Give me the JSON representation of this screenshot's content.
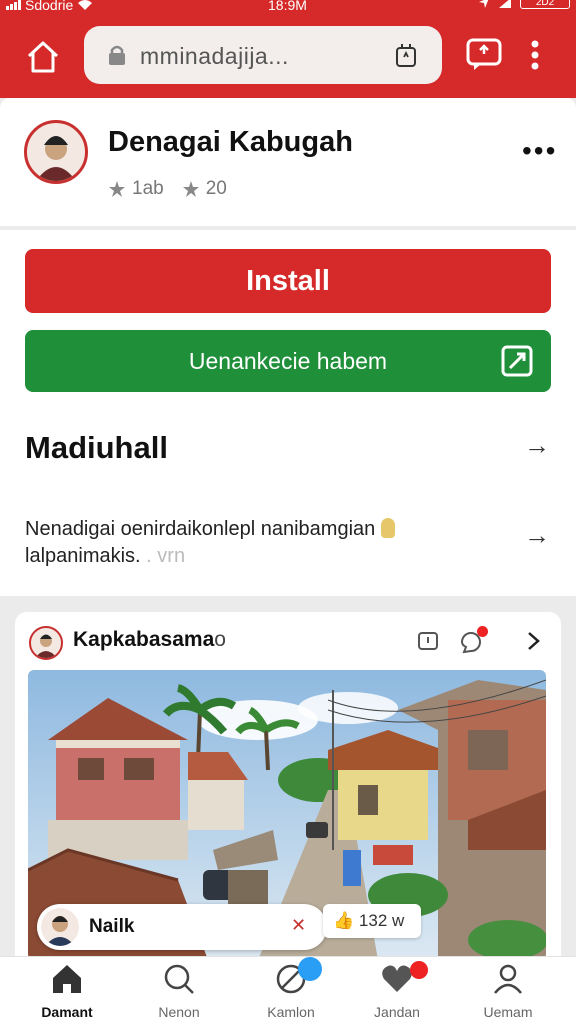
{
  "status_bar": {
    "carrier": "Sdodrie",
    "time": "18:9M",
    "battery": "2D2"
  },
  "browser": {
    "url": "mminadajija..."
  },
  "app": {
    "name": "Denagai Kabugah",
    "rating_count": "1ab",
    "rating_value": "20",
    "more_label": "•••"
  },
  "actions": {
    "install_label": "Install",
    "secondary_label": "Uenankecie habem"
  },
  "section": {
    "title": "Madiuhall",
    "description_line1": "Nenadigai oenirdaikonlepl nanibamgian",
    "description_line2": "lalpanimakis.",
    "description_fade": " . vrn"
  },
  "post": {
    "name_bold": "Kapkabasama",
    "name_light": "o",
    "author": "Nailk",
    "likes": "132 w"
  },
  "bottom_nav": {
    "items": [
      {
        "label": "Damant",
        "icon": "home-icon"
      },
      {
        "label": "Nenon",
        "icon": "search-icon"
      },
      {
        "label": "Kamlon",
        "icon": "compass-icon"
      },
      {
        "label": "Jandan",
        "icon": "heart-icon"
      },
      {
        "label": "Uemam",
        "icon": "profile-icon"
      }
    ]
  },
  "colors": {
    "brand_red": "#d62a2a",
    "accent_green": "#1f8f3a",
    "badge_blue": "#2a9df4"
  }
}
